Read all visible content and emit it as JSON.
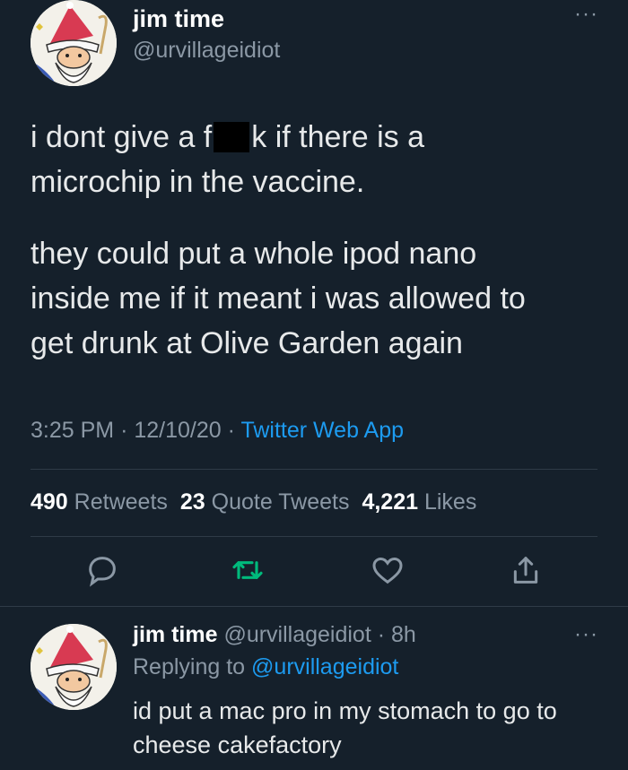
{
  "tweet": {
    "display_name": "jim time",
    "handle": "@urvillageidiot",
    "more_icon": "more-horizontal-icon",
    "text_line1_before": "i dont give a f",
    "text_line1_after": "k if there is a",
    "text_line2": "microchip in the vaccine.",
    "text_para2_line1": "they could put a whole ipod nano",
    "text_para2_line2": "inside me if it meant i was allowed to",
    "text_para2_line3": "get drunk at Olive Garden again",
    "time": "3:25 PM",
    "date": "12/10/20",
    "separator": "·",
    "source": "Twitter Web App",
    "retweets_count": "490",
    "retweets_label": "Retweets",
    "quotes_count": "23",
    "quotes_label": "Quote Tweets",
    "likes_count": "4,221",
    "likes_label": "Likes"
  },
  "actions": [
    "reply-icon",
    "retweet-icon",
    "like-icon",
    "share-icon"
  ],
  "reply": {
    "display_name": "jim time",
    "handle_time": "@urvillageidiot · 8h",
    "replying_to_label": "Replying to",
    "replying_to_handle": "@urvillageidiot",
    "text_line1": "id put a mac pro in my stomach to go to",
    "text_line2": "cheese cakefactory"
  },
  "colors": {
    "background": "#15202b",
    "accent": "#1d9bf0",
    "retweet_green": "#00ba7c",
    "muted": "#8b98a5"
  }
}
